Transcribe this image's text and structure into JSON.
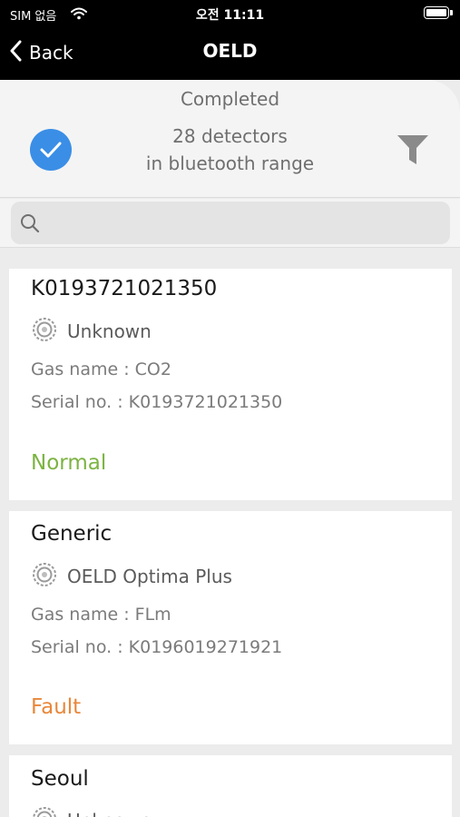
{
  "status_bar": {
    "carrier": "SIM 없음",
    "time": "오전 11:11"
  },
  "nav": {
    "back_label": "Back",
    "title": "OELD"
  },
  "header": {
    "status": "Completed",
    "count_line1": "28 detectors",
    "count_line2": "in bluetooth range"
  },
  "search": {
    "placeholder": "",
    "value": ""
  },
  "cards": [
    {
      "title": "K0193721021350",
      "model": "Unknown",
      "gas_line": "Gas name : CO2",
      "serial_line": "Serial no. : K0193721021350",
      "state": "Normal",
      "state_color": "#7cb342"
    },
    {
      "title": "Generic",
      "model": "OELD Optima Plus",
      "gas_line": "Gas name : FLm",
      "serial_line": "Serial no. : K0196019271921",
      "state": "Fault",
      "state_color": "#e8873a"
    },
    {
      "title": "Seoul",
      "model": "Unknown"
    }
  ],
  "colors": {
    "accent": "#3a8ee6",
    "normal": "#7cb342",
    "fault": "#e8873a"
  }
}
